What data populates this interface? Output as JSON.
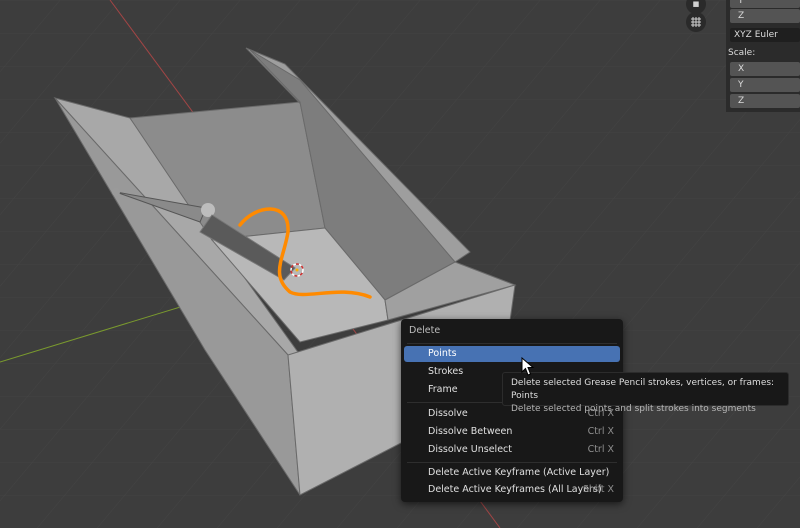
{
  "npanel": {
    "fields_top": [
      "Y",
      "Z"
    ],
    "rotation_mode": "XYZ Euler",
    "scale_label": "Scale:",
    "scale_fields": [
      "X",
      "Y",
      "Z"
    ]
  },
  "gizmo": {
    "camera_icon": "camera-icon",
    "grid_icon": "grid-icon"
  },
  "menu": {
    "title": "Delete",
    "items": [
      {
        "label": "Points",
        "shortcut": "",
        "active": true
      },
      {
        "label": "Strokes",
        "shortcut": ""
      },
      {
        "label": "Frame",
        "shortcut": ""
      },
      {
        "label": "Dissolve",
        "shortcut": "Ctrl X"
      },
      {
        "label": "Dissolve Between",
        "shortcut": "Ctrl X"
      },
      {
        "label": "Dissolve Unselect",
        "shortcut": "Ctrl X"
      },
      {
        "label": "Delete Active Keyframe (Active Layer)",
        "shortcut": ""
      },
      {
        "label": "Delete Active Keyframes (All Layers)",
        "shortcut": "Shift X"
      }
    ]
  },
  "tooltip": {
    "line1": "Delete selected Grease Pencil strokes, vertices, or frames:  Points",
    "line2": "Delete selected points and split strokes into segments"
  },
  "colors": {
    "menu_active": "#4772b3",
    "stroke": "#ff8a00",
    "axis_x": "#b04545",
    "axis_y": "#7a9a2e"
  }
}
